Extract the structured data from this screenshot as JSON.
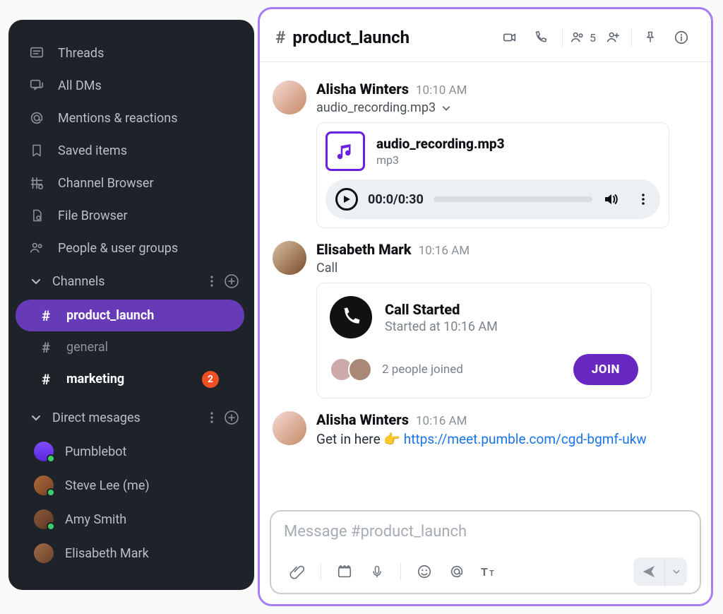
{
  "sidebar": {
    "nav": [
      {
        "label": "Threads",
        "icon": "threads-icon"
      },
      {
        "label": "All DMs",
        "icon": "dm-icon"
      },
      {
        "label": "Mentions & reactions",
        "icon": "mentions-icon"
      },
      {
        "label": "Saved items",
        "icon": "bookmark-icon"
      },
      {
        "label": "Channel Browser",
        "icon": "channel-browser-icon"
      },
      {
        "label": "File Browser",
        "icon": "file-browser-icon"
      },
      {
        "label": "People & user groups",
        "icon": "people-icon"
      }
    ],
    "channels_header": "Channels",
    "channels": [
      {
        "name": "product_launch",
        "active": true,
        "bold": true,
        "unread": null
      },
      {
        "name": "general",
        "active": false,
        "bold": false,
        "unread": null
      },
      {
        "name": "marketing",
        "active": false,
        "bold": true,
        "unread": "2"
      }
    ],
    "dms_header": "Direct mesages",
    "dms": [
      {
        "name": "Pumblebot",
        "status": "online",
        "avatar": "bot"
      },
      {
        "name": "Steve Lee (me)",
        "status": "online",
        "avatar": "a1"
      },
      {
        "name": "Amy Smith",
        "status": "online",
        "avatar": "a2"
      },
      {
        "name": "Elisabeth Mark",
        "status": "none",
        "avatar": "a3"
      }
    ]
  },
  "header": {
    "channel": "product_launch",
    "member_count": "5"
  },
  "messages": [
    {
      "author": "Alisha Winters",
      "time": "10:10 AM",
      "avatar": "a1",
      "attachment_label": "audio_recording.mp3",
      "attachment": {
        "filename": "audio_recording.mp3",
        "filetype": "mp3",
        "player_time": "00:0/0:30"
      }
    },
    {
      "author": "Elisabeth Mark",
      "time": "10:16 AM",
      "avatar": "a2",
      "subtext": "Call",
      "call": {
        "title": "Call Started",
        "subtitle": "Started at 10:16 AM",
        "joined_label": "2 people joined",
        "join_button": "JOIN"
      }
    },
    {
      "author": "Alisha Winters",
      "time": "10:16 AM",
      "avatar": "a1",
      "text_prefix": "Get in here ",
      "emoji": "👉",
      "link": "https://meet.pumble.com/cgd-bgmf-ukw"
    }
  ],
  "composer": {
    "placeholder": "Message #product_launch"
  },
  "colors": {
    "accent": "#673ab7",
    "border": "#a77df6",
    "badge": "#f04e23",
    "link": "#1a73e8"
  }
}
